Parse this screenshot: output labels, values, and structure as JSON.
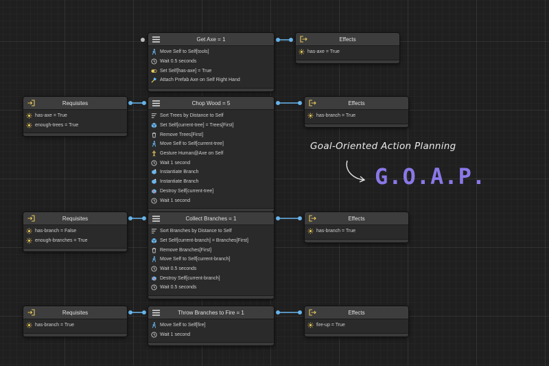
{
  "nodes": {
    "get_axe": {
      "title": "Get Axe = 1",
      "items": [
        {
          "icon": "walk-icon",
          "label": "Move Self to Self[tools]"
        },
        {
          "icon": "clock-icon",
          "label": "Wait 0.5 seconds"
        },
        {
          "icon": "toggle-icon",
          "label": "Set Self[has-axe] = True"
        },
        {
          "icon": "prefab-icon",
          "label": "Attach Prefab Axe on Self Right Hand"
        }
      ]
    },
    "chop_wood": {
      "title": "Chop Wood = 5",
      "items": [
        {
          "icon": "sort-icon",
          "label": "Sort Trees by Distance to Self"
        },
        {
          "icon": "cube-icon",
          "label": "Set Self[current-tree] = Trees[First]"
        },
        {
          "icon": "trash-icon",
          "label": "Remove Trees[First]"
        },
        {
          "icon": "walk-icon",
          "label": "Move Self to Self[current-tree]"
        },
        {
          "icon": "gesture-icon",
          "label": "Gesture Human@Axe on Self"
        },
        {
          "icon": "clock-icon",
          "label": "Wait 1 second"
        },
        {
          "icon": "instantiate-icon",
          "label": "Instantiate Branch"
        },
        {
          "icon": "instantiate-icon",
          "label": "Instantiate Branch"
        },
        {
          "icon": "destroy-icon",
          "label": "Destroy Self[current-tree]"
        },
        {
          "icon": "clock-icon",
          "label": "Wait 1 second"
        }
      ]
    },
    "collect_branches": {
      "title": "Collect Branches = 1",
      "items": [
        {
          "icon": "sort-icon",
          "label": "Sort Branches by Distance to Self"
        },
        {
          "icon": "cube-icon",
          "label": "Set Self[current-branch] = Branches[First]"
        },
        {
          "icon": "trash-icon",
          "label": "Remove Branches[First]"
        },
        {
          "icon": "walk-icon",
          "label": "Move Self to Self[current-branch]"
        },
        {
          "icon": "clock-icon",
          "label": "Wait 0.5 seconds"
        },
        {
          "icon": "destroy-icon",
          "label": "Destroy Self[current-branch]"
        },
        {
          "icon": "clock-icon",
          "label": "Wait 0.5 seconds"
        }
      ]
    },
    "throw_branches": {
      "title": "Throw Branches to Fire = 1",
      "items": [
        {
          "icon": "walk-icon",
          "label": "Move Self to Self[fire]"
        },
        {
          "icon": "clock-icon",
          "label": "Wait 1 second"
        }
      ]
    },
    "req_chop": {
      "title": "Requisites",
      "items": [
        {
          "icon": "sun-icon",
          "label": "has-axe = True"
        },
        {
          "icon": "sun-icon",
          "label": "enough-trees = True"
        }
      ]
    },
    "req_collect": {
      "title": "Requisites",
      "items": [
        {
          "icon": "sun-icon",
          "label": "has-branch = False"
        },
        {
          "icon": "sun-icon",
          "label": "enough-branches = True"
        }
      ]
    },
    "req_throw": {
      "title": "Requisites",
      "items": [
        {
          "icon": "sun-icon",
          "label": "has-branch = True"
        }
      ]
    },
    "eff_axe": {
      "title": "Effects",
      "items": [
        {
          "icon": "sun-icon",
          "label": "has-axe = True"
        }
      ]
    },
    "eff_chop": {
      "title": "Effects",
      "items": [
        {
          "icon": "sun-icon",
          "label": "has-branch = True"
        }
      ]
    },
    "eff_collect": {
      "title": "Effects",
      "items": [
        {
          "icon": "sun-icon",
          "label": "has-branch = True"
        }
      ]
    },
    "eff_throw": {
      "title": "Effects",
      "items": [
        {
          "icon": "sun-icon",
          "label": "fire-up = True"
        }
      ]
    }
  },
  "branding": {
    "subtitle": "Goal-Oriented Action Planning",
    "title": "G.O.A.P."
  },
  "colors": {
    "port": "#6ab7ee",
    "accent": "#8a78e8",
    "requisite_icon": "#e8c85a",
    "effect_icon": "#e8c85a"
  }
}
